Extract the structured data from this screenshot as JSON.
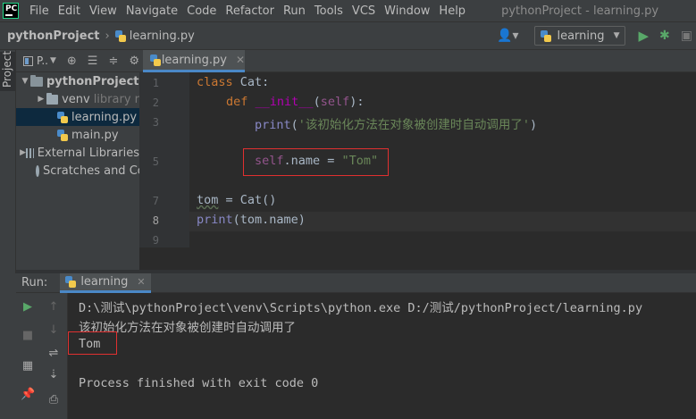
{
  "menubar": {
    "items": [
      "File",
      "Edit",
      "View",
      "Navigate",
      "Code",
      "Refactor",
      "Run",
      "Tools",
      "VCS",
      "Window",
      "Help"
    ],
    "window_title": "pythonProject - learning.py"
  },
  "navbar": {
    "project": "pythonProject",
    "file": "learning.py",
    "run_config": "learning"
  },
  "left_strip": {
    "tab": "Project"
  },
  "project_panel": {
    "header": "P..",
    "tree": [
      {
        "label": "pythonProject",
        "extra": "",
        "kind": "root"
      },
      {
        "label": "venv",
        "extra": "library r",
        "kind": "folder"
      },
      {
        "label": "learning.py",
        "extra": "",
        "kind": "file",
        "selected": true
      },
      {
        "label": "main.py",
        "extra": "",
        "kind": "file"
      },
      {
        "label": "External Libraries",
        "extra": "",
        "kind": "lib"
      },
      {
        "label": "Scratches and Co",
        "extra": "",
        "kind": "scratch"
      }
    ]
  },
  "editor": {
    "tab": "learning.py",
    "line_numbers": [
      "1",
      "2",
      "3",
      "5",
      "7",
      "8",
      "9"
    ],
    "code": {
      "l1_kw": "class",
      "l1_rest": " Cat:",
      "l2_kw": "def",
      "l2_fn": "__init__",
      "l2_open": "(",
      "l2_self": "self",
      "l2_close": "):",
      "l3_print": "print",
      "l3_str": "'该初始化方法在对象被创建时自动调用了'",
      "l3_close": ")",
      "l5_self": "self",
      "l5_rest": ".name = ",
      "l5_str": "\"Tom\"",
      "l7_var": "tom",
      "l7_rest": " = Cat()",
      "l8_print": "print",
      "l8_rest": "(tom.name)"
    }
  },
  "run_panel": {
    "label": "Run:",
    "tab": "learning",
    "console": [
      "D:\\测试\\pythonProject\\venv\\Scripts\\python.exe D:/测试/pythonProject/learning.py",
      "该初始化方法在对象被创建时自动调用了",
      "Tom",
      "Process finished with exit code 0"
    ]
  },
  "colors": {
    "accent": "#4a88c7",
    "highlight_box": "#e03030",
    "run_green": "#59a869"
  }
}
